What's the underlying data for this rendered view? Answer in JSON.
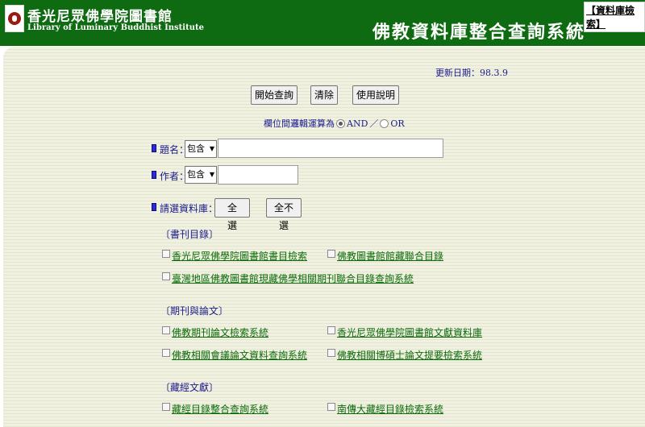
{
  "header": {
    "library_name_cn": "香光尼眾佛學院圖書館",
    "library_name_en": "Library of Luminary Buddhist Institute",
    "system_title": "佛教資料庫整合查詢系統",
    "db_search_link": "資料庫檢索",
    "colors": {
      "header_bg": "#0e6b12",
      "panel_bg": "#f1f1e1",
      "link": "#0b6b0b"
    }
  },
  "update_date": "更新日期：98.3.9",
  "toolbar": {
    "search_label": "開始查詢",
    "clear_label": "清除",
    "help_label": "使用說明"
  },
  "logic": {
    "label": "欄位間邏輯運算為",
    "and_label": "AND",
    "separator": "／",
    "or_label": "OR",
    "selected": "AND"
  },
  "fields": {
    "title_label": "題名：",
    "title_op": "包含",
    "title_value": "",
    "author_label": "作者：",
    "author_op": "包含",
    "author_value": ""
  },
  "db_select": {
    "label": "請選資料庫：",
    "all_label": "全　選",
    "none_label": "全不選"
  },
  "sections": [
    {
      "title": "〔書刊目錄〕",
      "items": [
        "香光尼眾佛學院圖書館書目檢索",
        "佛教圖書館館藏聯合目錄",
        "臺灣地區佛教圖書館現藏佛學相關期刊聯合目錄查詢系統"
      ]
    },
    {
      "title": "〔期刊與論文〕",
      "items": [
        "佛教期刊論文檢索系統",
        "香光尼眾佛學院圖書館文獻資料庫",
        "佛教相關會議論文資料查詢系統",
        "佛教相關博碩士論文提要檢索系統"
      ]
    },
    {
      "title": "〔藏經文獻〕",
      "items": [
        "藏經目錄整合查詢系統",
        "南傳大藏經目錄檢索系統"
      ]
    }
  ]
}
